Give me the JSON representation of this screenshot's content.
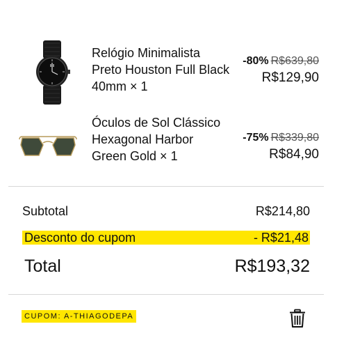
{
  "cart": {
    "items": [
      {
        "name": "Relógio Minimalista Preto Houston Full Black 40mm × 1",
        "discount": "-80%",
        "old_price": "R$639,80",
        "new_price": "R$129,90",
        "thumbnail_icon": "black-watch-image"
      },
      {
        "name": "Óculos de Sol Clássico Hexagonal Harbor Green Gold × 1",
        "discount": "-75%",
        "old_price": "R$339,80",
        "new_price": "R$84,90",
        "thumbnail_icon": "sunglasses-image"
      }
    ]
  },
  "summary": {
    "subtotal_label": "Subtotal",
    "subtotal_value": "R$214,80",
    "coupon_discount_label": "Desconto do cupom",
    "coupon_discount_value": "- R$21,48",
    "total_label": "Total",
    "total_value": "R$193,32"
  },
  "coupon": {
    "code_label": "CUPOM: A-THIAGODEPA",
    "remove_icon": "trash-icon",
    "highlight_color": "#ffe600"
  }
}
